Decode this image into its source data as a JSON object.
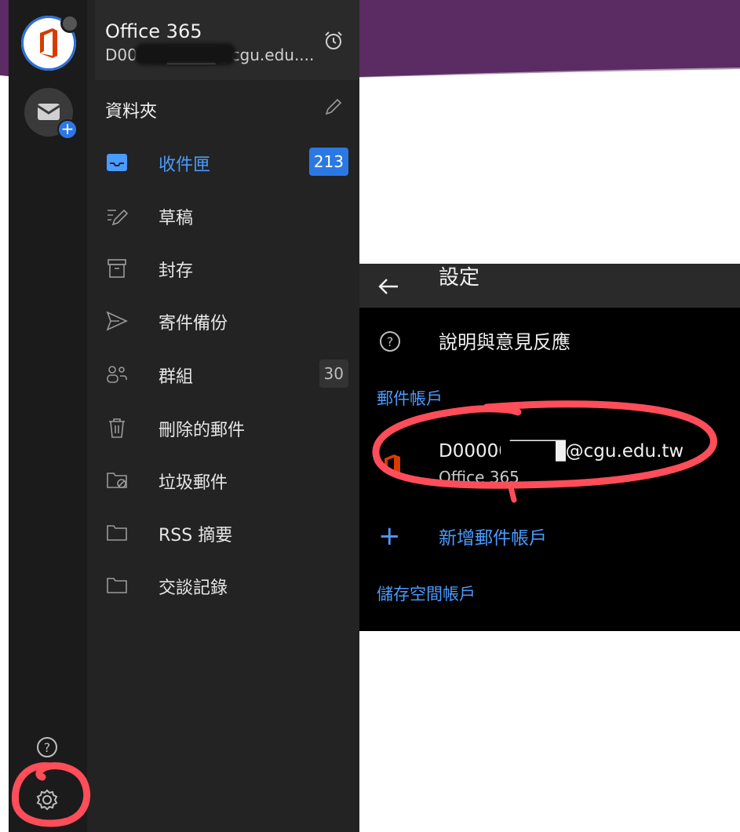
{
  "colors": {
    "banner_purple": "#5b2b63",
    "accent_blue": "#2b78e4",
    "annotation_red": "#ff4d5a",
    "office_red": "#d83b01"
  },
  "left_panel": {
    "account": {
      "title": "Office 365",
      "email": "D00000████@cgu.edu....",
      "icon": "office-365-logo"
    },
    "add_account_icon": "mail-plus-icon",
    "alarm_icon": "alarm-clock-icon",
    "folders_title": "資料夾",
    "edit_icon": "pencil-icon",
    "folders": [
      {
        "label": "收件匣",
        "count": "213",
        "icon": "inbox-icon",
        "active": true
      },
      {
        "label": "草稿",
        "count": "",
        "icon": "drafts-icon"
      },
      {
        "label": "封存",
        "count": "",
        "icon": "archive-icon"
      },
      {
        "label": "寄件備份",
        "count": "",
        "icon": "send-icon"
      },
      {
        "label": "群組",
        "count": "30",
        "icon": "groups-icon"
      },
      {
        "label": "刪除的郵件",
        "count": "",
        "icon": "trash-icon"
      },
      {
        "label": "垃圾郵件",
        "count": "",
        "icon": "junk-folder-icon"
      },
      {
        "label": "RSS 摘要",
        "count": "",
        "icon": "folder-icon"
      },
      {
        "label": "交談記錄",
        "count": "",
        "icon": "folder-icon"
      }
    ],
    "help_icon": "help-icon",
    "settings_icon": "gear-icon"
  },
  "right_panel": {
    "title": "設定",
    "back_icon": "back-arrow-icon",
    "help_item": "說明與意見反應",
    "section_mail_accounts": "郵件帳戶",
    "account_email": "D00000████@cgu.edu.tw",
    "account_type": "Office 365",
    "add_account": "新增郵件帳戶",
    "section_storage": "儲存空間帳戶"
  }
}
